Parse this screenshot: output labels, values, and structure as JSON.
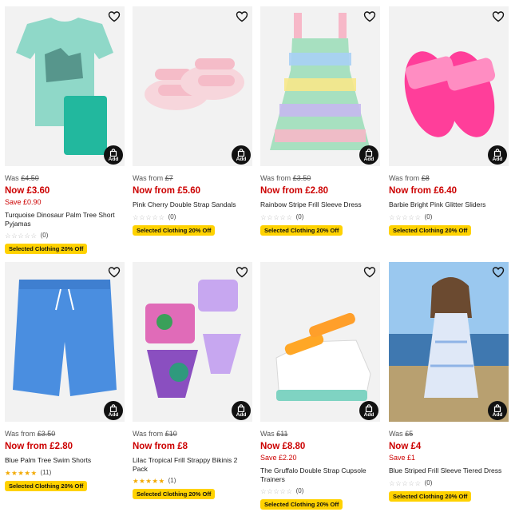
{
  "products": [
    {
      "was_label": "Was",
      "was_price": "£4.50",
      "now_label": "Now",
      "now_price": "£3.60",
      "save": "Save £0.90",
      "title": "Turquoise Dinosaur Palm Tree Short Pyjamas",
      "rating_count": "(0)",
      "badge": "Selected Clothing 20% Off",
      "add_label": "Add",
      "stars": 0
    },
    {
      "was_label": "Was from",
      "was_price": "£7",
      "now_label": "Now from",
      "now_price": "£5.60",
      "save": "",
      "title": "Pink Cherry Double Strap Sandals",
      "rating_count": "(0)",
      "badge": "Selected Clothing 20% Off",
      "add_label": "Add",
      "stars": 0
    },
    {
      "was_label": "Was from",
      "was_price": "£3.50",
      "now_label": "Now from",
      "now_price": "£2.80",
      "save": "",
      "title": "Rainbow Stripe Frill Sleeve Dress",
      "rating_count": "(0)",
      "badge": "Selected Clothing 20% Off",
      "add_label": "Add",
      "stars": 0
    },
    {
      "was_label": "Was from",
      "was_price": "£8",
      "now_label": "Now from",
      "now_price": "£6.40",
      "save": "",
      "title": "Barbie Bright Pink Glitter Sliders",
      "rating_count": "(0)",
      "badge": "Selected Clothing 20% Off",
      "add_label": "Add",
      "stars": 0
    },
    {
      "was_label": "Was from",
      "was_price": "£3.50",
      "now_label": "Now from",
      "now_price": "£2.80",
      "save": "",
      "title": "Blue Palm Tree Swim Shorts",
      "rating_count": "(11)",
      "badge": "Selected Clothing 20% Off",
      "add_label": "Add",
      "stars": 5
    },
    {
      "was_label": "Was from",
      "was_price": "£10",
      "now_label": "Now from",
      "now_price": "£8",
      "save": "",
      "title": "Lilac Tropical Frill Strappy Bikinis 2 Pack",
      "rating_count": "(1)",
      "badge": "Selected Clothing 20% Off",
      "add_label": "Add",
      "stars": 5
    },
    {
      "was_label": "Was",
      "was_price": "£11",
      "now_label": "Now",
      "now_price": "£8.80",
      "save": "Save £2.20",
      "title": "The Gruffalo Double Strap Cupsole Trainers",
      "rating_count": "(0)",
      "badge": "Selected Clothing 20% Off",
      "add_label": "Add",
      "stars": 0
    },
    {
      "was_label": "Was",
      "was_price": "£5",
      "now_label": "Now",
      "now_price": "£4",
      "save": "Save £1",
      "title": "Blue Striped Frill Sleeve Tiered Dress",
      "rating_count": "(0)",
      "badge": "Selected Clothing 20% Off",
      "add_label": "Add",
      "stars": 0
    }
  ],
  "icons": {
    "wishlist": "heart-icon",
    "add_to_bag": "bag-icon",
    "rating": "star-icon"
  },
  "colors": {
    "price_red": "#cc0000",
    "badge_yellow": "#ffd200",
    "star_gold": "#f2a900",
    "add_button": "#111111"
  }
}
